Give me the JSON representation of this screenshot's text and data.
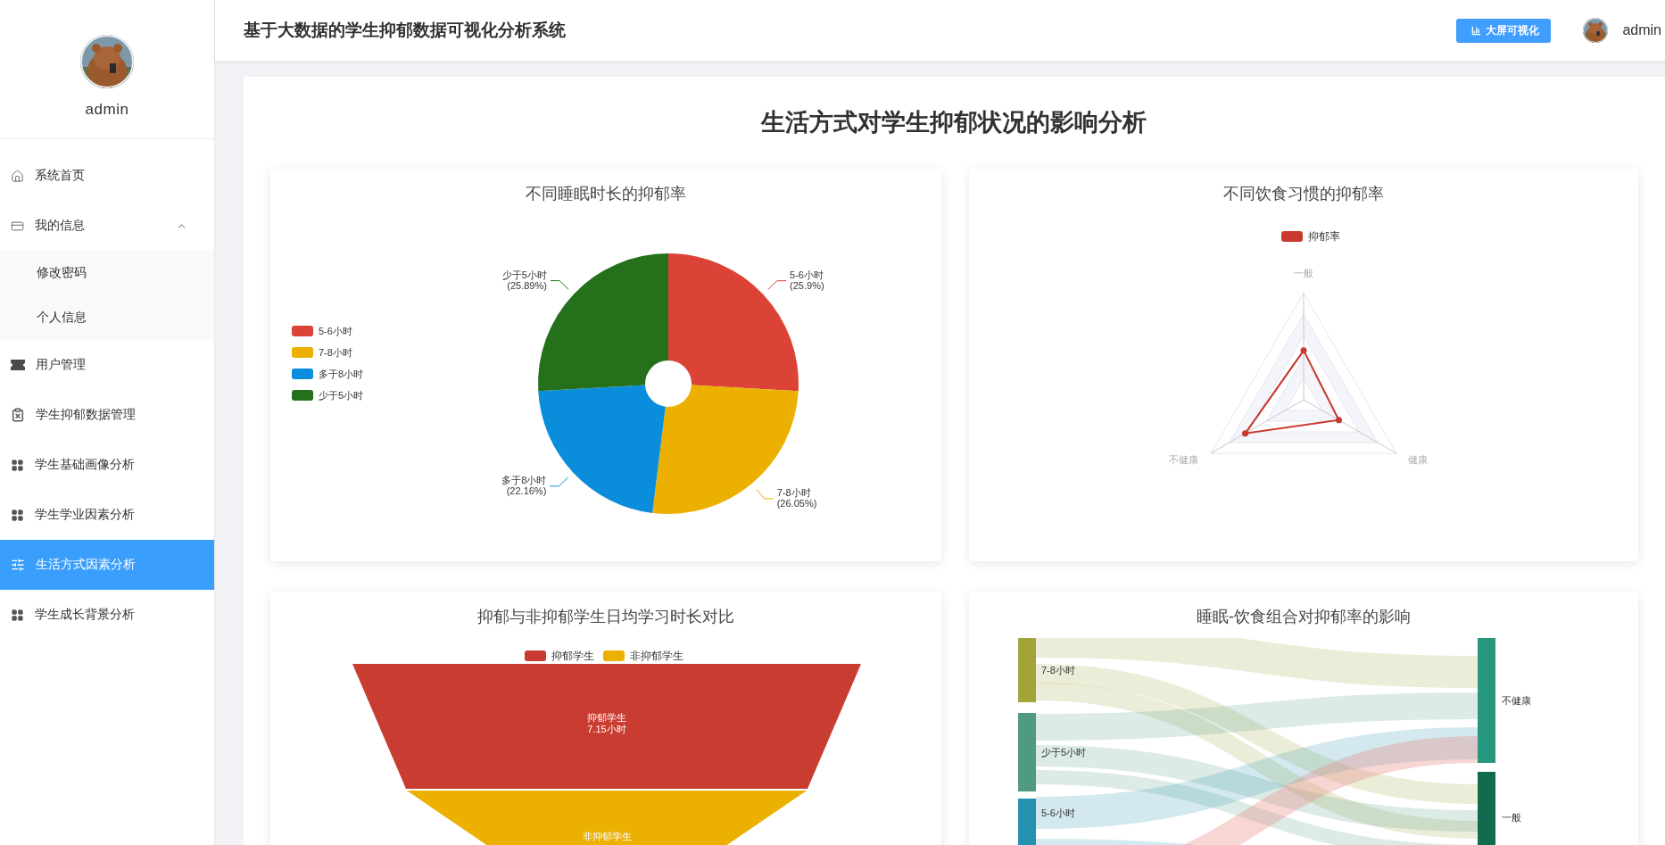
{
  "sidebar": {
    "user": {
      "name": "admin"
    },
    "items": [
      {
        "label": "系统首页",
        "selected": false
      },
      {
        "label": "我的信息",
        "selected": false,
        "expanded": true,
        "children": [
          {
            "label": "修改密码",
            "selected": false
          },
          {
            "label": "个人信息",
            "selected": false
          }
        ]
      },
      {
        "label": "用户管理",
        "selected": false
      },
      {
        "label": "学生抑郁数据管理",
        "selected": false
      },
      {
        "label": "学生基础画像分析",
        "selected": false
      },
      {
        "label": "学生学业因素分析",
        "selected": false
      },
      {
        "label": "生活方式因素分析",
        "selected": true
      },
      {
        "label": "学生成长背景分析",
        "selected": false
      }
    ]
  },
  "header": {
    "title": "基于大数据的学生抑郁数据可视化分析系统",
    "screen_button": "大屏可视化",
    "user": "admin"
  },
  "page_title": "生活方式对学生抑郁状况的影响分析",
  "sleep_chart": {
    "legend": [
      {
        "label": "5-6小时",
        "color": "#db4336"
      },
      {
        "label": "7-8小时",
        "color": "#ebb000"
      },
      {
        "label": "多于8小时",
        "color": "#0a8ddb"
      },
      {
        "label": "少于5小时",
        "color": "#25701b"
      }
    ],
    "chart_data": {
      "type": "donut",
      "title": "不同睡眠时长的抑郁率",
      "categories": [
        "5-6小时",
        "7-8小时",
        "多于8小时",
        "少于5小时"
      ],
      "series": [
        {
          "values": [
            25.9,
            26.05,
            22.16,
            25.89
          ]
        }
      ],
      "value_labels": [
        "(25.9%)",
        "(26.05%)",
        "(22.16%)",
        "(25.89%)"
      ]
    }
  },
  "diet_chart": {
    "title": "不同饮食习惯的抑郁率",
    "legend": [
      {
        "label": "抑郁率",
        "color": "#c9392f"
      }
    ],
    "axes": [
      "一般",
      "健康",
      "不健康"
    ]
  },
  "study_chart": {
    "title": "抑郁与非抑郁学生日均学习时长对比",
    "legend": [
      {
        "label": "抑郁学生",
        "color": "#c9392f"
      },
      {
        "label": "非抑郁学生",
        "color": "#ebb000"
      }
    ],
    "stages": [
      {
        "name": "抑郁学生",
        "value": "7.15小时",
        "color": "#c93c31"
      },
      {
        "name": "非抑郁学生",
        "color": "#ebb000"
      }
    ]
  },
  "combo_chart": {
    "title": "睡眠-饮食组合对抑郁率的影响",
    "sources": [
      {
        "label": "7-8小时",
        "color": "#a2a43a"
      },
      {
        "label": "少于5小时",
        "color": "#4f9a80"
      },
      {
        "label": "5-6小时",
        "color": "#2591b1"
      }
    ],
    "targets": [
      {
        "label": "不健康",
        "color": "#28977f"
      },
      {
        "label": "一般",
        "color": "#126b4c"
      }
    ]
  }
}
